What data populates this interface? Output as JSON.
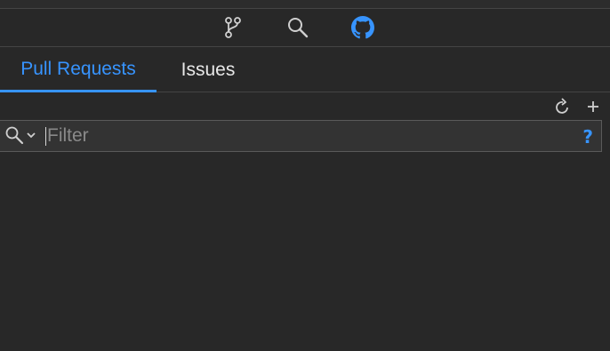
{
  "icon_bar": {
    "icons": [
      "git-branch-icon",
      "search-icon",
      "github-icon"
    ],
    "active_color": "#3794ff"
  },
  "tabs": [
    {
      "label": "Pull Requests",
      "active": true
    },
    {
      "label": "Issues",
      "active": false
    }
  ],
  "toolbar": {
    "icons": [
      "refresh-icon",
      "add-icon"
    ]
  },
  "filter": {
    "placeholder": "Filter",
    "value": "",
    "help_label": "?"
  },
  "colors": {
    "accent": "#3794ff",
    "background": "#282828"
  }
}
